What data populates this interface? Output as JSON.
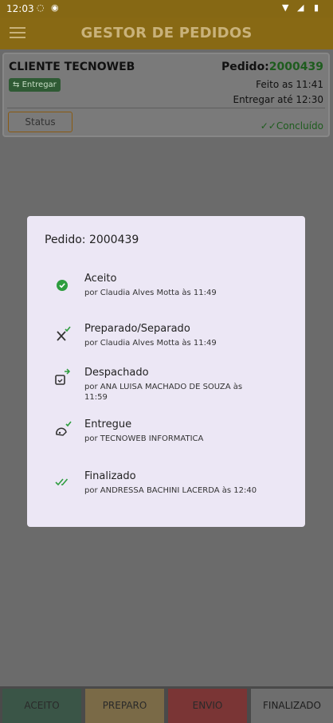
{
  "status_bar": {
    "time": "12:03"
  },
  "app": {
    "title": "GESTOR DE PEDIDOS"
  },
  "order_card": {
    "client": "CLIENTE TECNOWEB",
    "badge": "Entregar",
    "order_label": "Pedido:",
    "order_number": "2000439",
    "made_at": "Feito as 11:41",
    "deliver_until": "Entregar até 12:30",
    "status_button": "Status",
    "concluded": "Concluído"
  },
  "dialog": {
    "title": "Pedido: 2000439",
    "steps": [
      {
        "label": "Aceito",
        "by": "por Claudia Alves Motta às 11:49",
        "icon": "check-badge-icon"
      },
      {
        "label": "Preparado/Separado",
        "by": "por Claudia Alves Motta às 11:49",
        "icon": "utensils-check-icon"
      },
      {
        "label": "Despachado",
        "by": "por  ANA LUISA MACHADO DE SOUZA às 11:59",
        "icon": "calendar-dispatch-icon"
      },
      {
        "label": "Entregue",
        "by": "por TECNOWEB INFORMATICA",
        "icon": "delivery-check-icon"
      },
      {
        "label": "Finalizado",
        "by": "por ANDRESSA BACHINI LACERDA às 12:40",
        "icon": "double-check-icon"
      }
    ]
  },
  "tabs": [
    "ACEITO",
    "PREPARO",
    "ENVIO",
    "FINALIZADO"
  ],
  "colors": {
    "accent": "#886914",
    "success": "#2e9d3f"
  }
}
